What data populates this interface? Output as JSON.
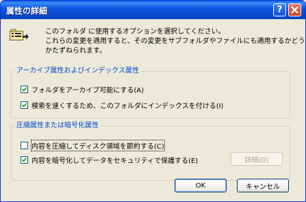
{
  "window": {
    "title": "属性の詳細",
    "help_glyph": "?",
    "close_glyph": "×"
  },
  "description": {
    "line1": "このフォルダ に使用するオプションを選択してください。",
    "line2": "これらの変更を適用すると、その変更をサブフォルダやファイルにも適用するかどう",
    "line3": "かたずねられます。"
  },
  "archive_group": {
    "title": "アーカイブ属性およびインデックス属性",
    "archive_checkbox": {
      "label": "フォルダをアーカイブ可能にする(A)",
      "checked": true
    },
    "index_checkbox": {
      "label": "検索を速くするため、このフォルダにインデックスを付ける(I)",
      "checked": true
    }
  },
  "compress_group": {
    "title": "圧縮属性または暗号化属性",
    "compress_checkbox": {
      "label": "内容を圧縮してディスク領域を節約する(C)",
      "checked": false
    },
    "encrypt_checkbox": {
      "label": "内容を暗号化してデータをセキュリティで保護する(E)",
      "checked": true
    },
    "details_label": "詳細(D)"
  },
  "buttons": {
    "ok_label": "OK",
    "cancel_label": "キャンセル"
  },
  "icons": {
    "folder_options": "folder-options-icon",
    "check": "check-icon"
  },
  "colors": {
    "title_bar": "#0b58df",
    "group_title": "#0046d5",
    "checkmark": "#21a121"
  }
}
